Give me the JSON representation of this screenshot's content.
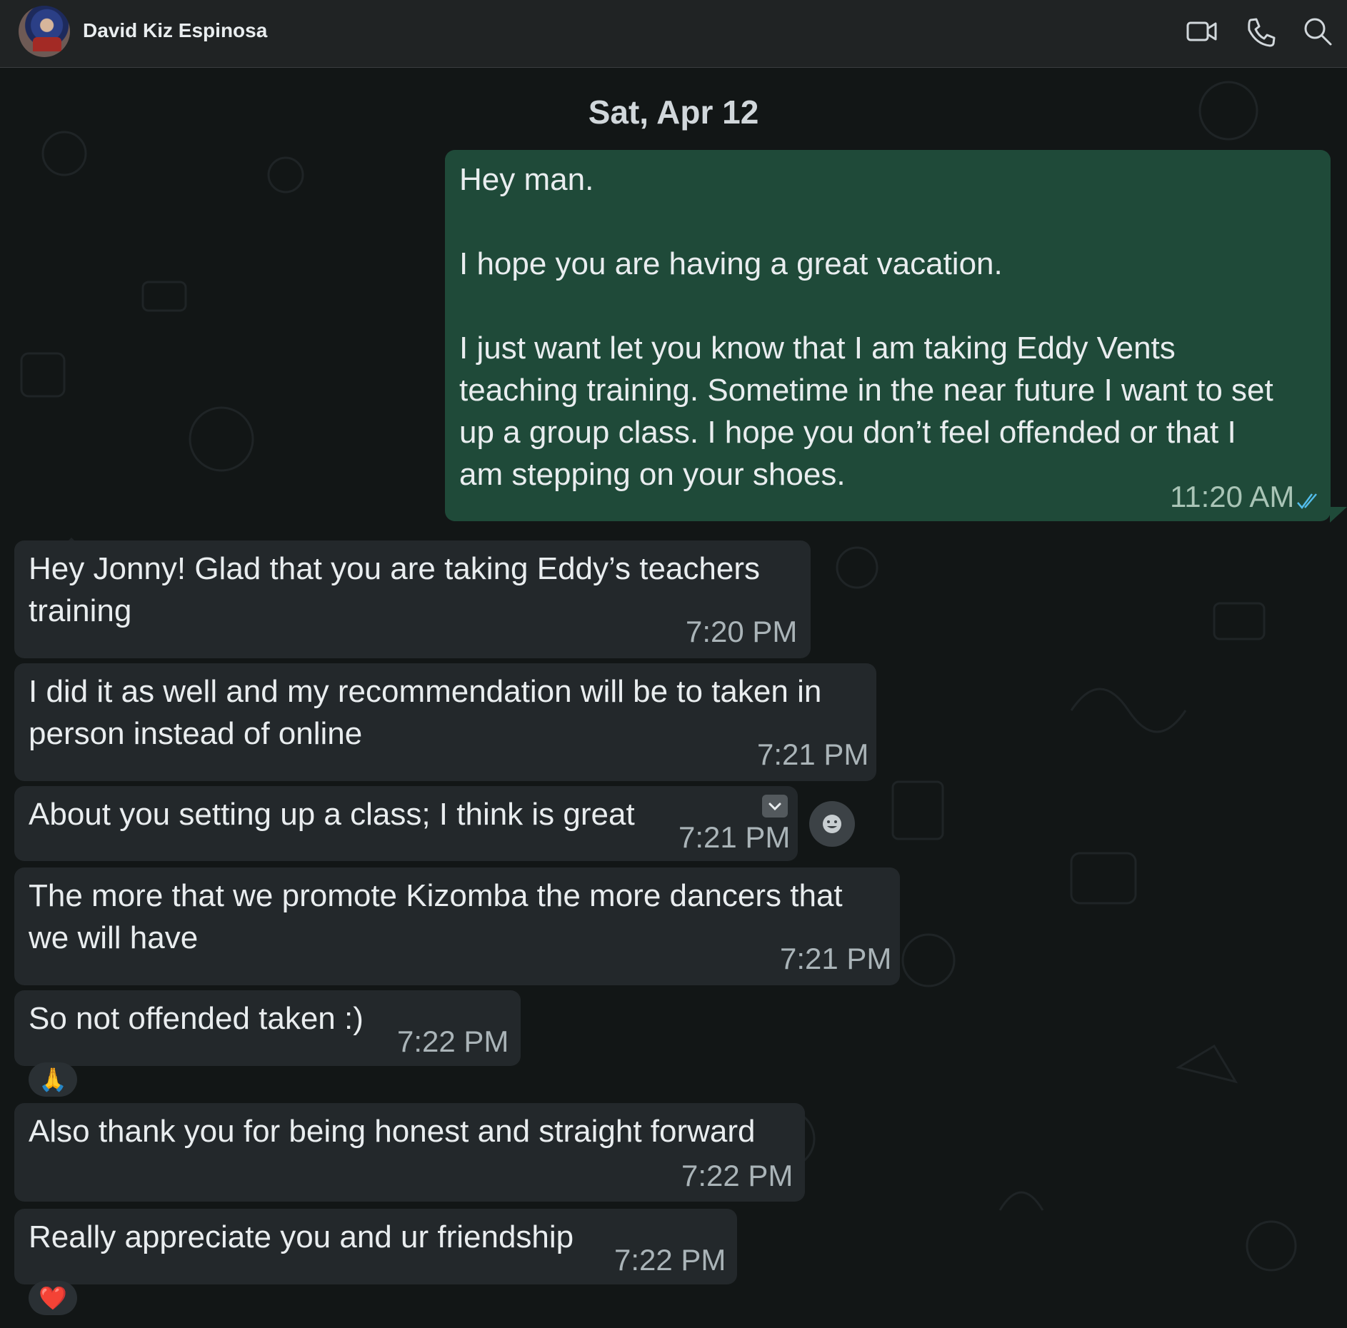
{
  "header": {
    "contact_name": "David Kiz Espinosa",
    "icons": [
      "video-camera-icon",
      "phone-icon",
      "search-icon"
    ]
  },
  "date_separator": "Sat, Apr 12",
  "messages": [
    {
      "direction": "outgoing",
      "text": "Hey man.\n\nI hope you are having a great vacation.\n\nI just want let you know that I am taking Eddy Vents\nteaching training. Sometime in the near future I want to set\nup a group class. I hope you don’t feel offended or that I\nam stepping on your shoes.",
      "time": "11:20 AM",
      "status": "read"
    },
    {
      "direction": "incoming",
      "text": "Hey Jonny! Glad that you are taking Eddy’s teachers\ntraining",
      "time": "7:20 PM"
    },
    {
      "direction": "incoming",
      "text": "I did it as well and my recommendation will be to taken in\nperson instead of online",
      "time": "7:21 PM"
    },
    {
      "direction": "incoming",
      "text": "About you setting up a class; I think is great",
      "time": "7:21 PM"
    },
    {
      "direction": "incoming",
      "text": "The more that we promote Kizomba the more dancers that\nwe will have",
      "time": "7:21 PM"
    },
    {
      "direction": "incoming",
      "text": "So not offended taken :)",
      "time": "7:22 PM",
      "reaction": "🙏"
    },
    {
      "direction": "incoming",
      "text": "Also thank you for being honest and straight forward",
      "time": "7:22 PM"
    },
    {
      "direction": "incoming",
      "text": "Really appreciate you and ur friendship",
      "time": "7:22 PM",
      "reaction": "❤️"
    }
  ],
  "colors": {
    "outgoing_bubble": "#1f4a39",
    "incoming_bubble": "#23282b",
    "read_tick": "#53bdeb",
    "header_bg": "#202324"
  }
}
